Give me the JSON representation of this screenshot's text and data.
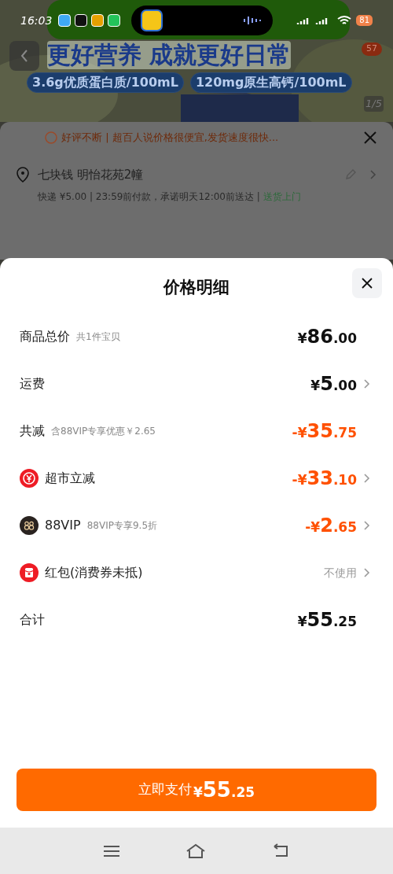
{
  "status_bar": {
    "time": "16:03",
    "battery": "81"
  },
  "product_banner": {
    "headline": "更好营养 成就更好日常",
    "tags": [
      "3.6g优质蛋白质/100mL",
      "120mg原生高钙/100mL"
    ],
    "cart_badge": "57",
    "page_counter": "1/5"
  },
  "order_sheet": {
    "review": "好评不断 | 超百人说价格很便宜,发货速度很快...",
    "address": "七块钱 明怡花苑2幢",
    "delivery": "快递 ¥5.00 | 23:59前付款，承诺明天12:00前送达 | ",
    "delivery_link": "送货上门"
  },
  "price_sheet": {
    "title": "价格明细",
    "rows": [
      {
        "kind": "plain",
        "label": "商品总价",
        "note": "共1件宝贝",
        "amount": "¥86.00",
        "discount": false,
        "chevron": false
      },
      {
        "kind": "plain",
        "label": "运费",
        "amount": "¥5.00",
        "discount": false,
        "chevron": true
      },
      {
        "kind": "plain",
        "label": "共减",
        "note": "含88VIP专享优惠￥2.65",
        "amount": "-¥35.75",
        "discount": true,
        "chevron": false
      },
      {
        "kind": "coupon",
        "label": "超市立减",
        "amount": "-¥33.10",
        "discount": true,
        "chevron": true
      },
      {
        "kind": "vip",
        "label": "88VIP",
        "note": "88VIP专享9.5折",
        "amount": "-¥2.65",
        "discount": true,
        "chevron": true
      },
      {
        "kind": "redpacket",
        "label": "红包(消费券未抵)",
        "value": "不使用",
        "chevron": true
      },
      {
        "kind": "plain",
        "label": "合计",
        "amount": "¥55.25",
        "discount": false,
        "chevron": false
      }
    ],
    "pay_button": {
      "label": "立即支付",
      "amount": "¥55.25"
    }
  }
}
